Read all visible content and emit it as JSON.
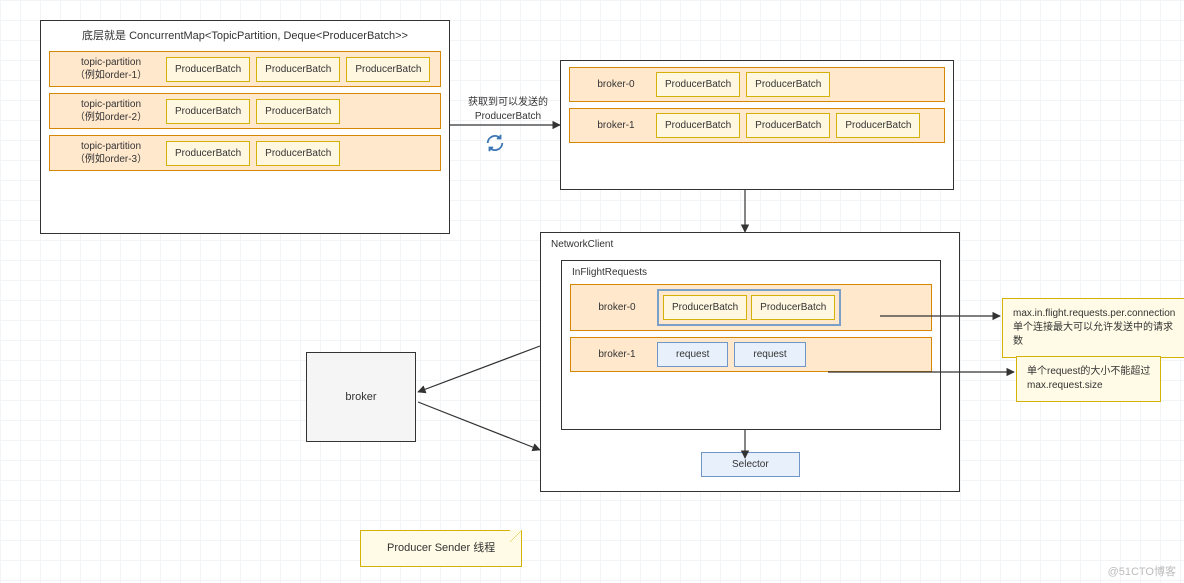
{
  "leftPanel": {
    "title": "底层就是 ConcurrentMap<TopicPartition, Deque<ProducerBatch>>",
    "rows": [
      {
        "tp": "topic-partition",
        "tpExample": "（例如order-1）",
        "batches": [
          "ProducerBatch",
          "ProducerBatch",
          "ProducerBatch"
        ]
      },
      {
        "tp": "topic-partition",
        "tpExample": "（例如order-2）",
        "batches": [
          "ProducerBatch",
          "ProducerBatch"
        ]
      },
      {
        "tp": "topic-partition",
        "tpExample": "（例如order-3）",
        "batches": [
          "ProducerBatch",
          "ProducerBatch"
        ]
      }
    ]
  },
  "edgeLabel": {
    "line1": "获取到可以发送的",
    "line2": "ProducerBatch"
  },
  "topRight": {
    "rows": [
      {
        "broker": "broker-0",
        "batches": [
          "ProducerBatch",
          "ProducerBatch"
        ]
      },
      {
        "broker": "broker-1",
        "batches": [
          "ProducerBatch",
          "ProducerBatch",
          "ProducerBatch"
        ]
      }
    ]
  },
  "networkClient": {
    "title": "NetworkClient",
    "inflight": {
      "title": "InFlightRequests",
      "rows": [
        {
          "broker": "broker-0",
          "cells": [
            "ProducerBatch",
            "ProducerBatch"
          ],
          "style": "pb"
        },
        {
          "broker": "broker-1",
          "cells": [
            "request",
            "request"
          ],
          "style": "req"
        }
      ]
    },
    "selector": "Selector"
  },
  "brokerBox": "broker",
  "notes": {
    "inflight": {
      "line1": "max.in.flight.requests.per.connection",
      "line2": "单个连接最大可以允许发送中的请求数"
    },
    "reqsize": {
      "line1": "单个request的大小不能超过",
      "line2": "max.request.size"
    },
    "title": "Producer Sender 线程"
  },
  "watermark": "@51CTO博客"
}
